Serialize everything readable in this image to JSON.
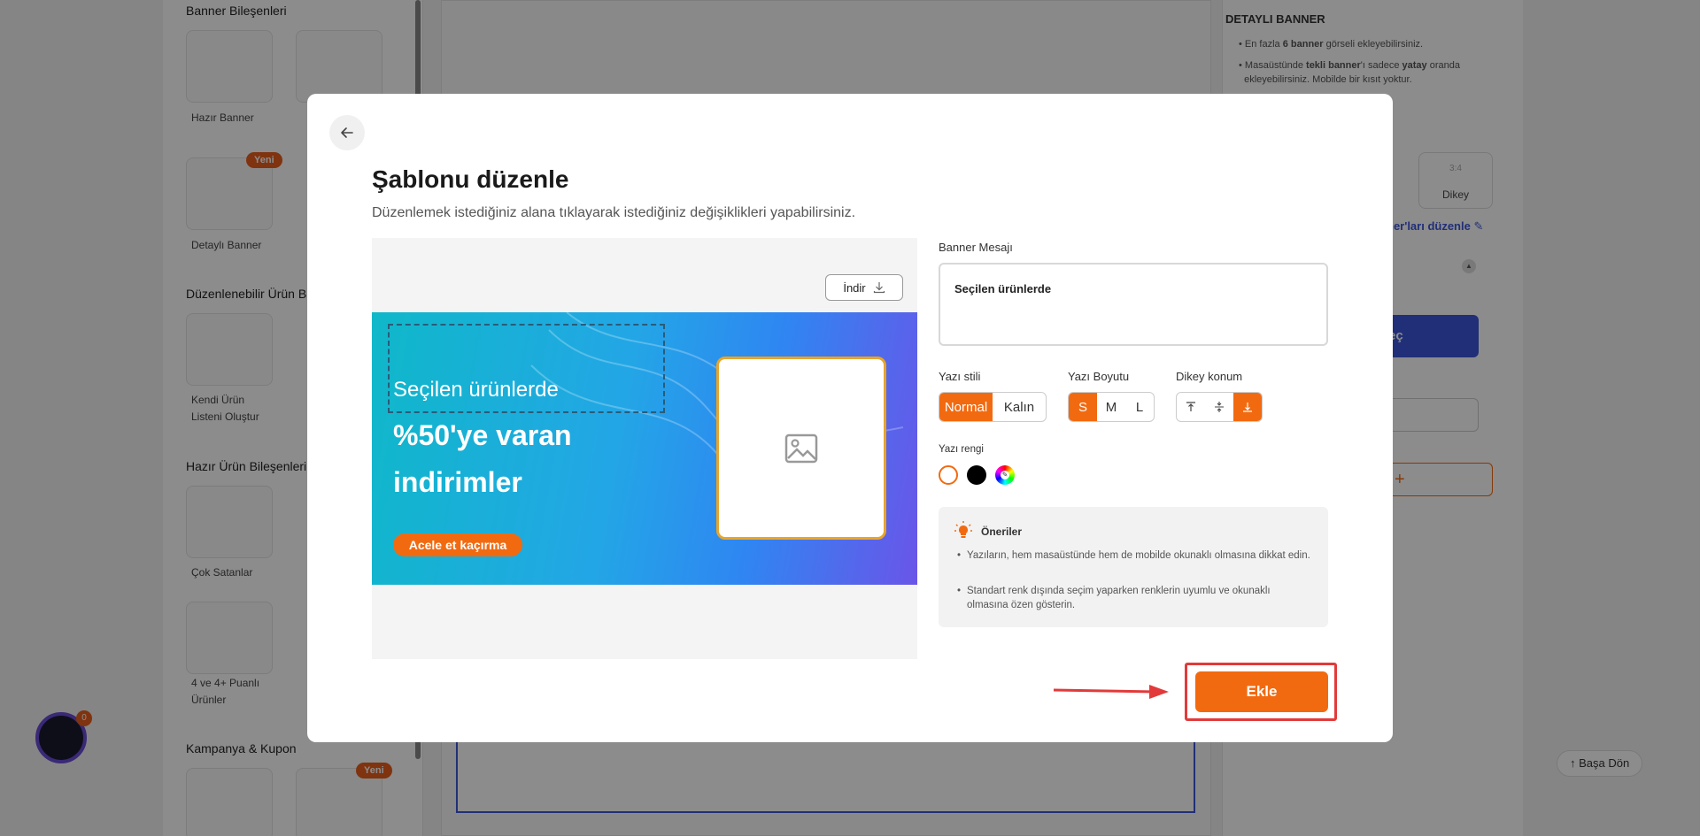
{
  "background": {
    "left_sections": {
      "banner_components": "Banner Bileşenleri",
      "editable_products": "Düzenlenebilir Ürün B",
      "ready_products": "Hazır Ürün Bileşenleri",
      "campaign": "Kampanya & Kupon"
    },
    "tiles": {
      "ready_banner": "Hazır Banner",
      "detailed_banner": "Detaylı Banner",
      "own_list_1": "Kendi Ürün",
      "own_list_2": "Listeni Oluştur",
      "best_sellers": "Çok Satanlar",
      "rated_1": "4 ve 4+ Puanlı",
      "rated_2": "Ürünler"
    },
    "new_badge": "Yeni",
    "right_title": "DETAYLI BANNER",
    "right_bullet_1_a": "En fazla ",
    "right_bullet_1_b": "6 banner",
    "right_bullet_1_c": " görseli ekleyebilirsiniz.",
    "right_bullet_2_a": "Masaüstünde ",
    "right_bullet_2_b": "tekli banner",
    "right_bullet_2_c": "'ı sadece ",
    "right_bullet_2_d": "yatay",
    "right_bullet_2_e": " oranda",
    "right_bullet_2_f": "ekleyebilirsiniz. Mobilde bir kısıt yoktur.",
    "ratio_label": "3:4",
    "vertical_label": "Dikey",
    "edit_banners_link": "ner'ları düzenle",
    "select_button": "eç",
    "add_plus": "+",
    "fab_badge": "0",
    "back_to_top": "Başa Dön"
  },
  "modal": {
    "title": "Şablonu düzenle",
    "subtitle": "Düzenlemek istediğiniz alana tıklayarak istediğiniz değişiklikleri yapabilirsiniz.",
    "download_label": "İndir",
    "banner": {
      "message": "Seçilen ürünlerde",
      "headline_1": "%50'ye varan",
      "headline_2": "indirimler",
      "cta": "Acele et kaçırma"
    },
    "form": {
      "message_label": "Banner Mesajı",
      "message_value": "Seçilen ürünlerde",
      "style_label": "Yazı stili",
      "style_options": [
        "Normal",
        "Kalın"
      ],
      "style_selected": "Normal",
      "size_label": "Yazı Boyutu",
      "size_options": [
        "S",
        "M",
        "L"
      ],
      "size_selected": "S",
      "vpos_label": "Dikey konum",
      "vpos_selected": "bottom",
      "color_label": "Yazı rengi",
      "colors": [
        "#ffffff",
        "#000000",
        "custom"
      ],
      "color_selected": "#ffffff"
    },
    "tips": {
      "title": "Öneriler",
      "items": [
        "Yazıların, hem masaüstünde hem de mobilde okunaklı olmasına dikkat edin.",
        "Standart renk dışında seçim yaparken renklerin uyumlu ve okunaklı olmasına özen gösterin."
      ]
    },
    "add_button": "Ekle"
  },
  "colors": {
    "accent": "#f26a10",
    "highlight_frame": "#e23a3a",
    "selection_blue": "#3b56d9"
  }
}
